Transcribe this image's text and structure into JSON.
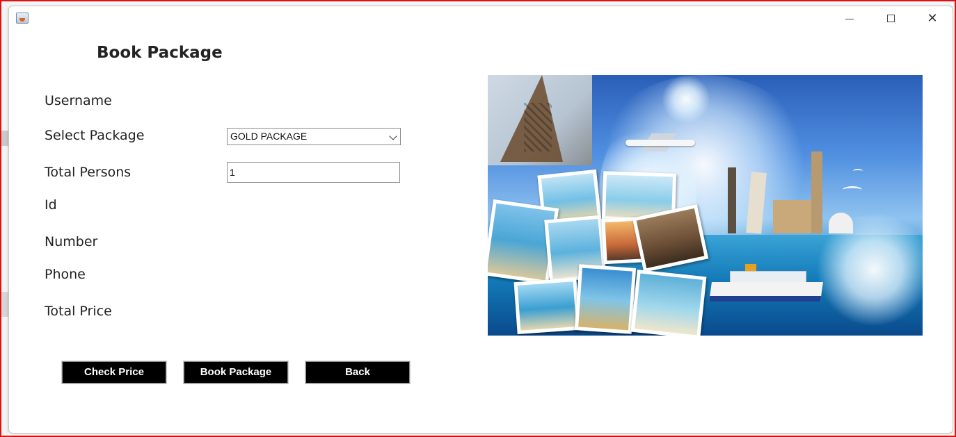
{
  "window": {
    "controls": {
      "minimize": "",
      "maximize": "",
      "close": "✕"
    }
  },
  "form": {
    "heading": "Book Package",
    "labels": {
      "username": "Username",
      "select_package": "Select Package",
      "total_persons": "Total Persons",
      "id": "Id",
      "number": "Number",
      "phone": "Phone",
      "total_price": "Total Price"
    },
    "package_select": {
      "selected": "GOLD PACKAGE"
    },
    "total_persons_input": {
      "value": "1"
    }
  },
  "buttons": {
    "check_price": "Check Price",
    "book_package": "Book Package",
    "back": "Back"
  },
  "colors": {
    "frame": "#e01010",
    "button_bg": "#000000",
    "button_text": "#ffffff"
  }
}
